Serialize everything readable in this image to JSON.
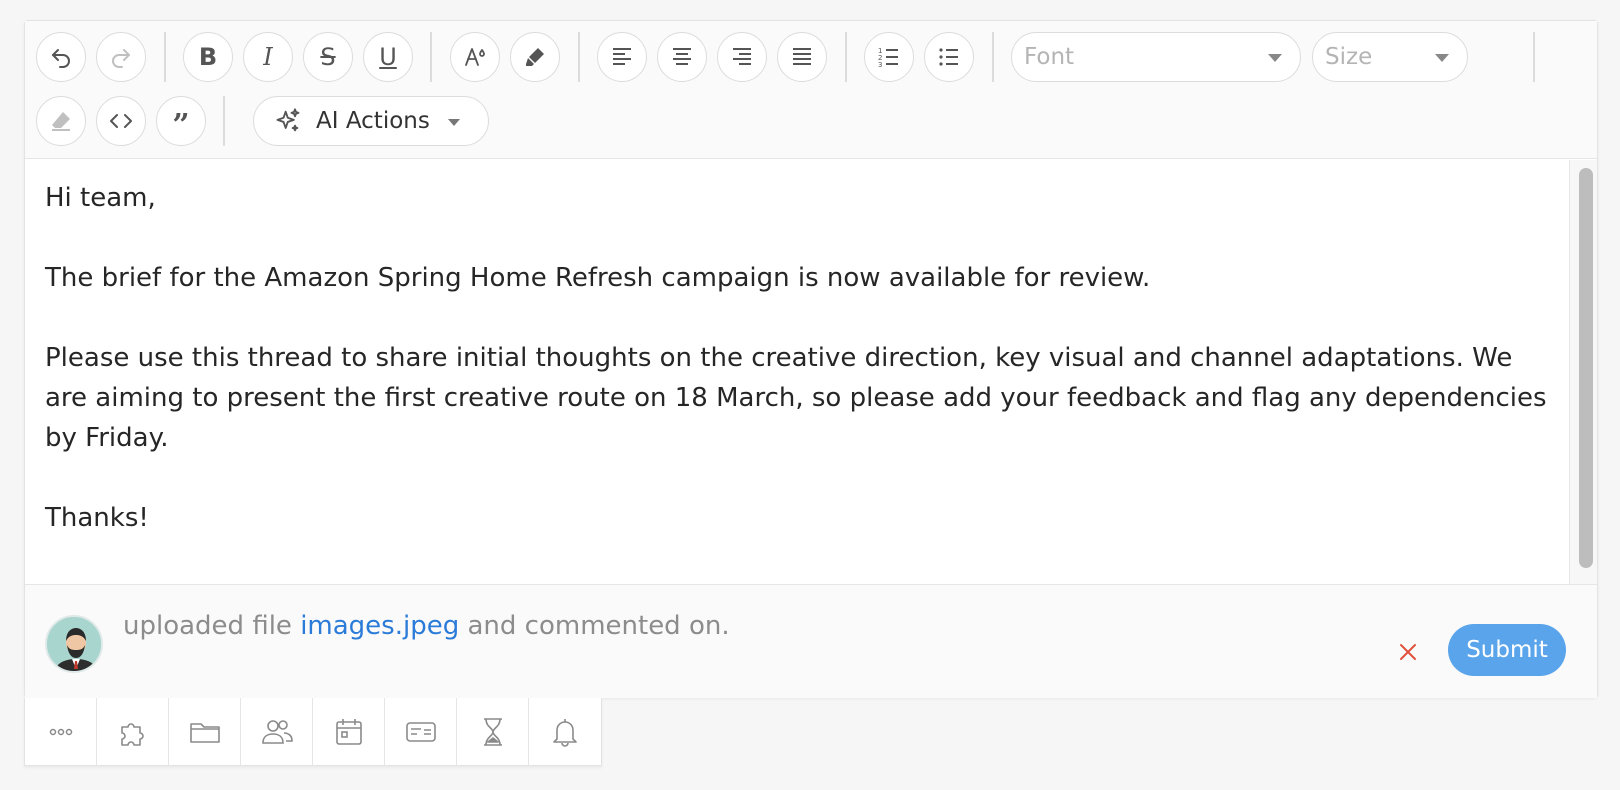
{
  "toolbar": {
    "font_placeholder": "Font",
    "size_placeholder": "Size",
    "ai_actions_label": "AI Actions"
  },
  "message": {
    "greeting": "Hi team,",
    "paragraph1": "The brief for the Amazon Spring Home Refresh campaign is now available for review.",
    "paragraph2": "Please use this thread to share initial thoughts on the creative direction, key visual and channel adaptations. We are aiming to present the first creative route on 18 March, so please add your feedback and flag any dependencies by Friday.",
    "closing": "Thanks!"
  },
  "footer": {
    "activity_prefix": "uploaded file",
    "file_name": "images.jpeg",
    "activity_suffix": "and commented on.",
    "submit_label": "Submit"
  },
  "colors": {
    "submit_bg": "#5aa4ec",
    "link": "#2b7bd8",
    "cancel_x": "#e0523e"
  },
  "bottom_bar_icons": [
    "more-icon",
    "puzzle-icon",
    "folder-icon",
    "users-icon",
    "calendar-icon",
    "id-card-icon",
    "hourglass-icon",
    "bell-icon"
  ]
}
